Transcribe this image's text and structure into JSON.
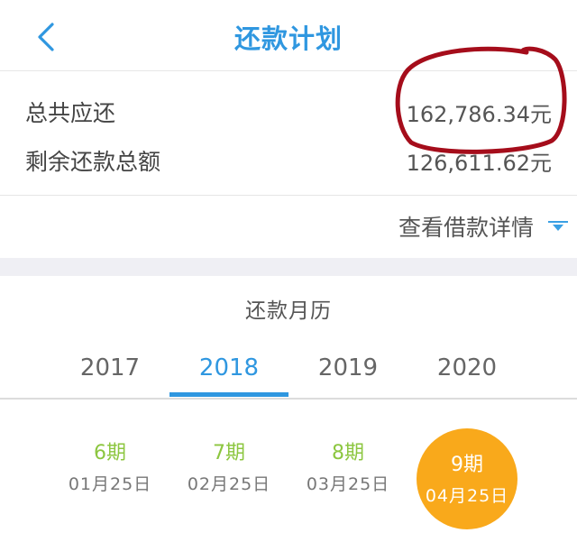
{
  "header": {
    "title": "还款计划",
    "back_icon": "chevron-left-icon",
    "accent_color": "#2f97e0"
  },
  "summary": {
    "total_label": "总共应还",
    "total_value": "162,786.34元",
    "remaining_label": "剩余还款总额",
    "remaining_value": "126,611.62元",
    "annotation_color": "#a50d1b"
  },
  "details": {
    "link_label": "查看借款详情",
    "caret_icon": "caret-down-icon"
  },
  "calendar": {
    "title": "还款月历",
    "years": [
      "2017",
      "2018",
      "2019",
      "2020"
    ],
    "selected_year": "2018",
    "periods": [
      {
        "label": "6期",
        "date": "01月25日"
      },
      {
        "label": "7期",
        "date": "02月25日"
      },
      {
        "label": "8期",
        "date": "03月25日"
      },
      {
        "label": "9期",
        "date": "04月25日"
      }
    ],
    "selected_period": "9期",
    "period_color": "#8cc63f",
    "active_color": "#f9a91b"
  }
}
